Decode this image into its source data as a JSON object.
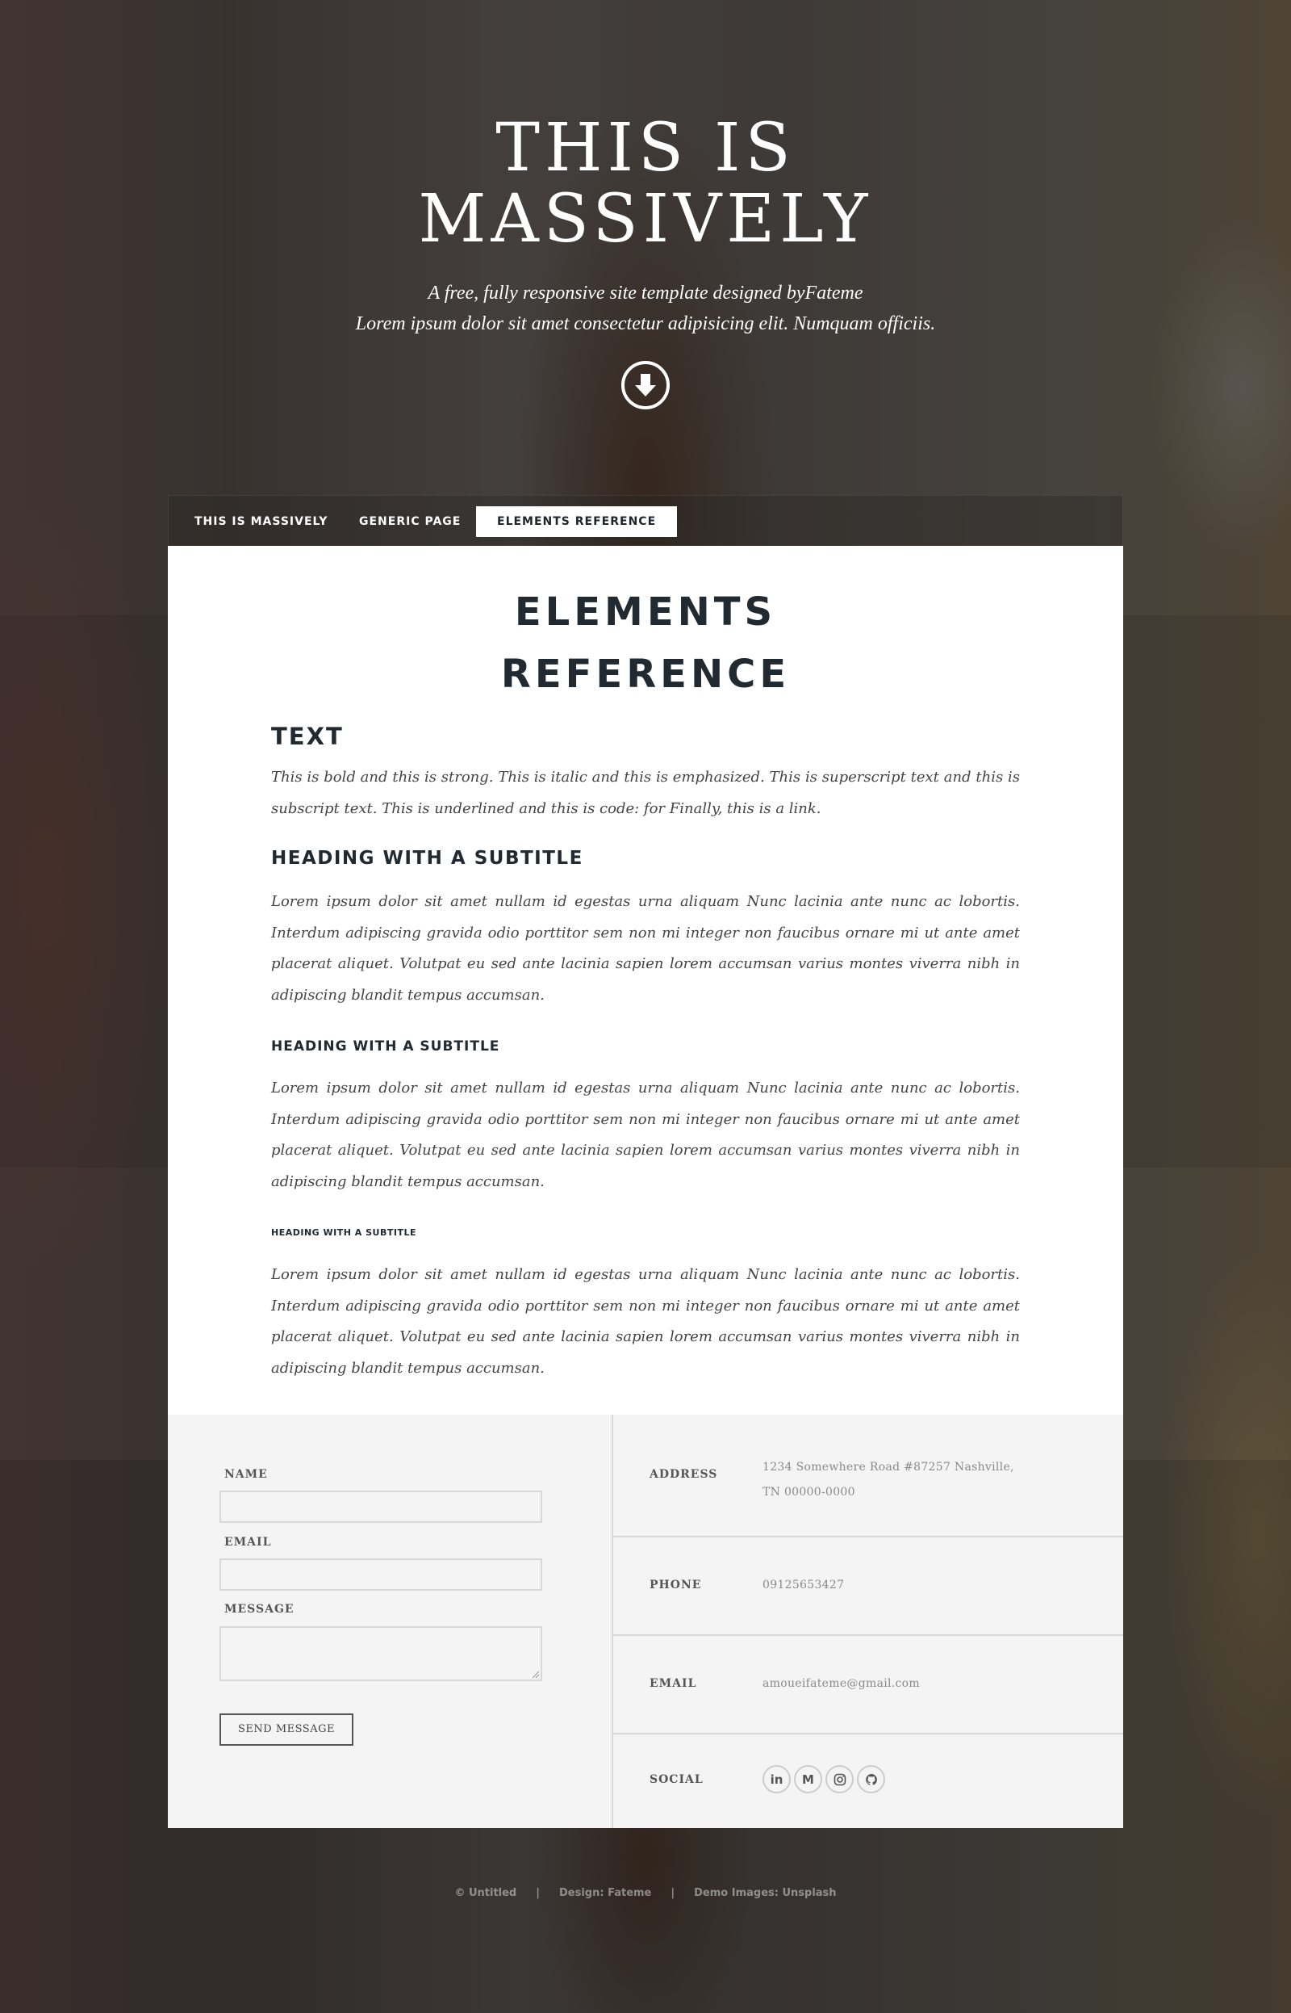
{
  "hero": {
    "title_line1": "THIS IS",
    "title_line2": "MASSIVELY",
    "subtitle_line1": "A free, fully responsive site template designed byFateme",
    "subtitle_line2": "Lorem ipsum dolor sit amet consectetur adipisicing elit. Numquam officiis.",
    "arrow_icon": "arrow-down-circle-icon"
  },
  "nav": {
    "items": [
      {
        "label": "THIS IS MASSIVELY"
      },
      {
        "label": "GENERIC PAGE"
      },
      {
        "label": "ELEMENTS REFERENCE",
        "active": true
      }
    ]
  },
  "main": {
    "title_line1": "ELEMENTS",
    "title_line2": "REFERENCE",
    "sections": [
      {
        "heading": "TEXT",
        "text": "This is bold and this is strong. This is italic and this is emphasized. This is superscript text and this is subscript text. This is underlined and this is code: for Finally, this is a link."
      },
      {
        "heading": "HEADING WITH A SUBTITLE",
        "text": "Lorem ipsum dolor sit amet nullam id egestas urna aliquam Nunc lacinia ante nunc ac lobortis. Interdum adipiscing gravida odio porttitor sem non mi integer non faucibus ornare mi ut ante amet placerat aliquet. Volutpat eu sed ante lacinia sapien lorem accumsan varius montes viverra nibh in adipiscing blandit tempus accumsan."
      },
      {
        "heading": "HEADING WITH A SUBTITLE",
        "text": "Lorem ipsum dolor sit amet nullam id egestas urna aliquam Nunc lacinia ante nunc ac lobortis. Interdum adipiscing gravida odio porttitor sem non mi integer non faucibus ornare mi ut ante amet placerat aliquet. Volutpat eu sed ante lacinia sapien lorem accumsan varius montes viverra nibh in adipiscing blandit tempus accumsan."
      },
      {
        "heading": "HEADING WITH A SUBTITLE",
        "text": "Lorem ipsum dolor sit amet nullam id egestas urna aliquam Nunc lacinia ante nunc ac lobortis. Interdum adipiscing gravida odio porttitor sem non mi integer non faucibus ornare mi ut ante amet placerat aliquet. Volutpat eu sed ante lacinia sapien lorem accumsan varius montes viverra nibh in adipiscing blandit tempus accumsan."
      }
    ]
  },
  "form": {
    "name_label": "NAME",
    "email_label": "EMAIL",
    "message_label": "MESSAGE",
    "name_value": "",
    "email_value": "",
    "message_value": "",
    "send_label": "SEND MESSAGE"
  },
  "contact": {
    "address_label": "ADDRESS",
    "address_line1": "1234 Somewhere Road #87257 Nashville,",
    "address_line2": "TN 00000-0000",
    "phone_label": "PHONE",
    "phone_value": "09125653427",
    "email_label": "EMAIL",
    "email_value": "amoueifateme@gmail.com",
    "social_label": "SOCIAL",
    "social_icons": [
      {
        "name": "linkedin-icon",
        "glyph": "in"
      },
      {
        "name": "medium-icon",
        "glyph": "M"
      },
      {
        "name": "instagram-icon",
        "glyph": ""
      },
      {
        "name": "github-icon",
        "glyph": ""
      }
    ]
  },
  "copyright": {
    "items": [
      "© Untitled",
      "Design: Fateme",
      "Demo Images: Unsplash"
    ]
  },
  "colors": {
    "text_dark": "#212931",
    "panel_bg": "#f4f4f4",
    "border": "#d8d8d8",
    "white": "#ffffff"
  }
}
